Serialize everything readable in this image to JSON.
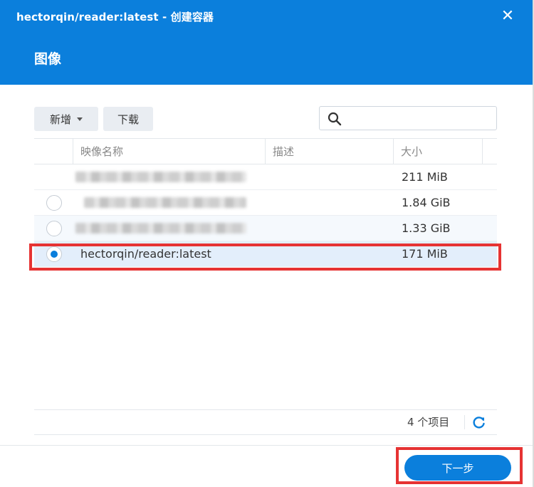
{
  "window": {
    "title": "hectorqin/reader:latest - 创建容器",
    "step_title": "图像",
    "close_symbol": "✕"
  },
  "toolbar": {
    "add_label": "新增",
    "download_label": "下载",
    "search": {
      "value": "",
      "placeholder": "",
      "icon": "search-icon"
    }
  },
  "table": {
    "columns": [
      "映像名称",
      "描述",
      "大小"
    ],
    "rows": [
      {
        "name": "",
        "description": "",
        "size": "211 MiB",
        "selected": false,
        "has_radio": false,
        "name_obscured": true
      },
      {
        "name": "",
        "description": "",
        "size": "1.84 GiB",
        "selected": false,
        "has_radio": true,
        "name_obscured": true
      },
      {
        "name": "",
        "description": "",
        "size": "1.33 GiB",
        "selected": false,
        "has_radio": true,
        "name_obscured": true
      },
      {
        "name": "hectorqin/reader:latest",
        "description": "",
        "size": "171 MiB",
        "selected": true,
        "has_radio": true,
        "name_obscured": false
      }
    ]
  },
  "footer": {
    "item_count": "4 个项目",
    "refresh_icon": "refresh-icon"
  },
  "actions": {
    "next_label": "下一步"
  },
  "colors": {
    "header": "#0b7fdc",
    "primary": "#0b7fdc",
    "highlight": "#e63333"
  }
}
